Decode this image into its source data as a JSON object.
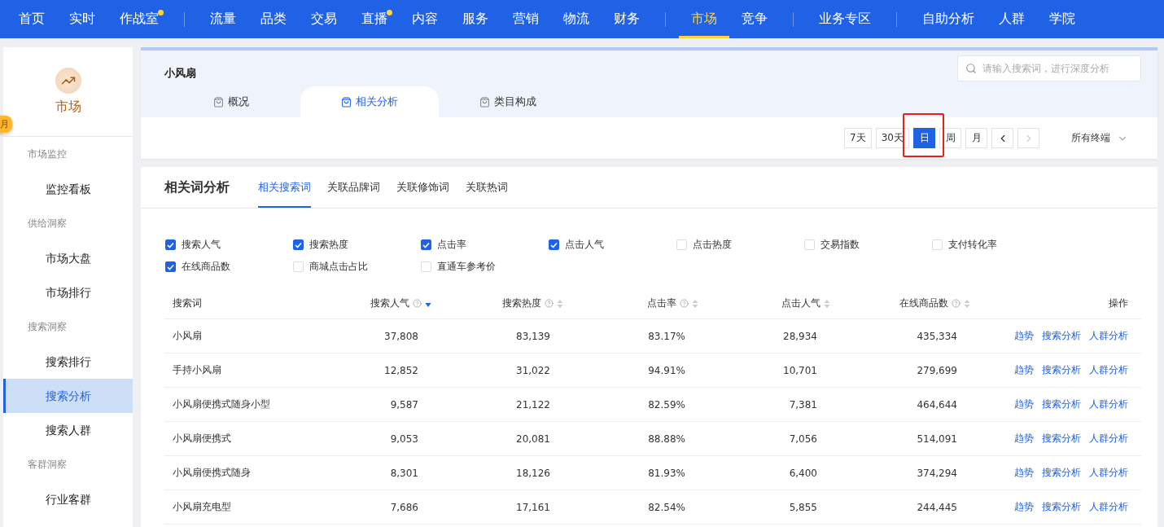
{
  "nav_groups": [
    {
      "items": [
        {
          "label": "首页",
          "selected": false,
          "dot": false
        },
        {
          "label": "实时",
          "selected": false,
          "dot": false
        },
        {
          "label": "作战室",
          "selected": false,
          "dot": true
        }
      ]
    },
    {
      "items": [
        {
          "label": "流量",
          "selected": false,
          "dot": false
        },
        {
          "label": "品类",
          "selected": false,
          "dot": false
        },
        {
          "label": "交易",
          "selected": false,
          "dot": false
        },
        {
          "label": "直播",
          "selected": false,
          "dot": true
        },
        {
          "label": "内容",
          "selected": false,
          "dot": false
        },
        {
          "label": "服务",
          "selected": false,
          "dot": false
        },
        {
          "label": "营销",
          "selected": false,
          "dot": false
        },
        {
          "label": "物流",
          "selected": false,
          "dot": false
        },
        {
          "label": "财务",
          "selected": false,
          "dot": false
        }
      ]
    },
    {
      "items": [
        {
          "label": "市场",
          "selected": true,
          "dot": false
        },
        {
          "label": "竞争",
          "selected": false,
          "dot": false
        }
      ]
    },
    {
      "items": [
        {
          "label": "业务专区",
          "selected": false,
          "dot": false
        }
      ]
    },
    {
      "items": [
        {
          "label": "自助分析",
          "selected": false,
          "dot": false
        },
        {
          "label": "人群",
          "selected": false,
          "dot": false
        },
        {
          "label": "学院",
          "selected": false,
          "dot": false
        }
      ]
    }
  ],
  "side_tag": "月",
  "sidebar": {
    "title": "市场",
    "sections": [
      {
        "heading": "市场监控",
        "items": [
          {
            "label": "监控看板",
            "selected": false
          }
        ]
      },
      {
        "heading": "供给洞察",
        "items": [
          {
            "label": "市场大盘",
            "selected": false
          },
          {
            "label": "市场排行",
            "selected": false
          }
        ]
      },
      {
        "heading": "搜索洞察",
        "items": [
          {
            "label": "搜索排行",
            "selected": false
          },
          {
            "label": "搜索分析",
            "selected": true
          },
          {
            "label": "搜索人群",
            "selected": false
          }
        ]
      },
      {
        "heading": "客群洞察",
        "items": [
          {
            "label": "行业客群",
            "selected": false
          }
        ]
      }
    ]
  },
  "keyword": "小风扇",
  "search": {
    "placeholder": "请输入搜索词，进行深度分析"
  },
  "tabs": [
    {
      "label": "概况",
      "selected": false
    },
    {
      "label": "相关分析",
      "selected": true
    },
    {
      "label": "类目构成",
      "selected": false
    }
  ],
  "range_buttons": [
    {
      "label": "7天",
      "selected": false,
      "highlighted": false
    },
    {
      "label": "30天",
      "selected": false,
      "highlighted": false
    },
    {
      "label": "日",
      "selected": true,
      "highlighted": true
    },
    {
      "label": "周",
      "selected": false,
      "highlighted": false
    },
    {
      "label": "月",
      "selected": false,
      "highlighted": false
    }
  ],
  "terminal": "所有终端",
  "panel": {
    "title": "相关词分析",
    "tabs": [
      {
        "label": "相关搜索词",
        "selected": true
      },
      {
        "label": "关联品牌词",
        "selected": false
      },
      {
        "label": "关联修饰词",
        "selected": false
      },
      {
        "label": "关联热词",
        "selected": false
      }
    ]
  },
  "metrics": [
    {
      "label": "搜索人气",
      "checked": true
    },
    {
      "label": "搜索热度",
      "checked": true
    },
    {
      "label": "点击率",
      "checked": true
    },
    {
      "label": "点击人气",
      "checked": true
    },
    {
      "label": "点击热度",
      "checked": false
    },
    {
      "label": "交易指数",
      "checked": false
    },
    {
      "label": "支付转化率",
      "checked": false
    },
    {
      "label": "在线商品数",
      "checked": true
    },
    {
      "label": "商城点击占比",
      "checked": false
    },
    {
      "label": "直通车参考价",
      "checked": false
    }
  ],
  "table": {
    "columns": [
      {
        "label": "搜索词",
        "help": false,
        "sortable": false
      },
      {
        "label": "搜索人气",
        "help": true,
        "sortable": true,
        "sorted": true
      },
      {
        "label": "搜索热度",
        "help": true,
        "sortable": true,
        "sorted": false
      },
      {
        "label": "点击率",
        "help": true,
        "sortable": true,
        "sorted": false
      },
      {
        "label": "点击人气",
        "help": false,
        "sortable": true,
        "sorted": false
      },
      {
        "label": "在线商品数",
        "help": true,
        "sortable": true,
        "sorted": false
      },
      {
        "label": "操作",
        "help": false,
        "sortable": false
      }
    ],
    "rows": [
      {
        "cells": [
          "小风扇",
          "37,808",
          "83,139",
          "83.17%",
          "28,934",
          "435,334"
        ],
        "actions": [
          "趋势",
          "搜索分析",
          "人群分析"
        ]
      },
      {
        "cells": [
          "手持小风扇",
          "12,852",
          "31,022",
          "94.91%",
          "10,701",
          "279,699"
        ],
        "actions": [
          "趋势",
          "搜索分析",
          "人群分析"
        ]
      },
      {
        "cells": [
          "小风扇便携式随身小型",
          "9,587",
          "21,122",
          "82.59%",
          "7,381",
          "464,644"
        ],
        "actions": [
          "趋势",
          "搜索分析",
          "人群分析"
        ]
      },
      {
        "cells": [
          "小风扇便携式",
          "9,053",
          "20,081",
          "88.88%",
          "7,056",
          "514,091"
        ],
        "actions": [
          "趋势",
          "搜索分析",
          "人群分析"
        ]
      },
      {
        "cells": [
          "小风扇便携式随身",
          "8,301",
          "18,126",
          "81.93%",
          "6,400",
          "374,294"
        ],
        "actions": [
          "趋势",
          "搜索分析",
          "人群分析"
        ]
      },
      {
        "cells": [
          "小风扇充电型",
          "7,686",
          "17,161",
          "82.54%",
          "5,855",
          "244,445"
        ],
        "actions": [
          "趋势",
          "搜索分析",
          "人群分析"
        ]
      }
    ]
  }
}
